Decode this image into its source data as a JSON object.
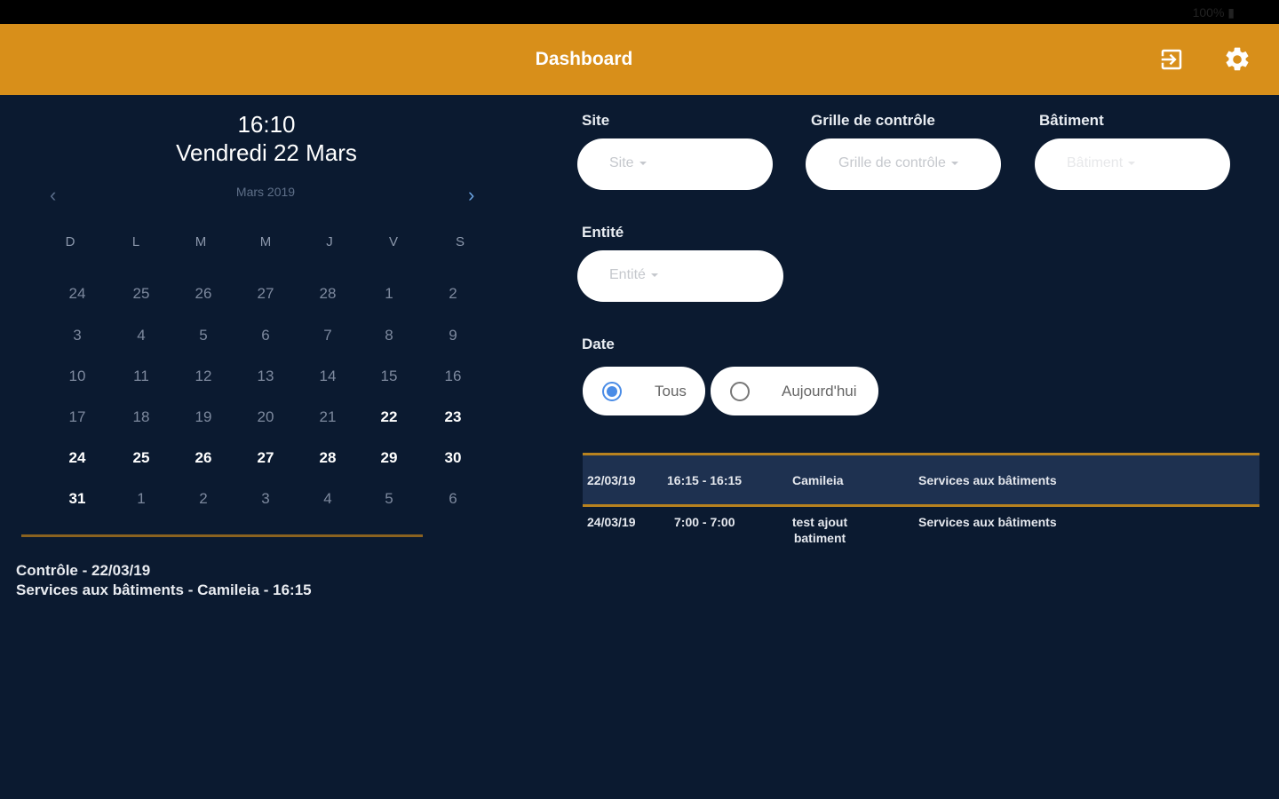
{
  "status_bar": {
    "text": "100% ▮"
  },
  "appbar": {
    "title": "Dashboard",
    "logout_icon": "logout-icon",
    "settings_icon": "gear-icon",
    "color": "#d88f1a"
  },
  "left": {
    "time": "16:10",
    "date_long": "Vendredi 22 Mars",
    "calendar": {
      "month_label": "Mars 2019",
      "prev": "‹",
      "next": "›",
      "weekdays": [
        "D",
        "L",
        "M",
        "M",
        "J",
        "V",
        "S"
      ],
      "weeks": [
        [
          "24",
          "25",
          "26",
          "27",
          "28",
          "1",
          "2"
        ],
        [
          "3",
          "4",
          "5",
          "6",
          "7",
          "8",
          "9"
        ],
        [
          "10",
          "11",
          "12",
          "13",
          "14",
          "15",
          "16"
        ],
        [
          "17",
          "18",
          "19",
          "20",
          "21",
          "22",
          "23"
        ],
        [
          "24",
          "25",
          "26",
          "27",
          "28",
          "29",
          "30"
        ],
        [
          "31",
          "1",
          "2",
          "3",
          "4",
          "5",
          "6"
        ]
      ],
      "selected_day": "22"
    },
    "event": {
      "line1": "Contrôle - 22/03/19",
      "line2": "Services aux bâtiments - Camileia - 16:15"
    }
  },
  "filters": {
    "site": {
      "label": "Site",
      "placeholder": "Site"
    },
    "grille": {
      "label": "Grille de contrôle",
      "placeholder": "Grille de contrôle"
    },
    "batiment": {
      "label": "Bâtiment",
      "placeholder": "Bâtiment"
    },
    "entite": {
      "label": "Entité",
      "placeholder": "Entité"
    },
    "date": {
      "label": "Date",
      "options": [
        "Tous",
        "Aujourd'hui"
      ],
      "selected": "Tous"
    }
  },
  "table": {
    "rows": [
      {
        "date": "22/03/19",
        "time": "16:15 - 16:15",
        "entity": "Camileia",
        "service": "Services aux bâtiments"
      },
      {
        "date": "24/03/19",
        "time": "7:00 - 7:00",
        "entity": "test ajout batiment",
        "service": "Services aux bâtiments"
      }
    ]
  }
}
